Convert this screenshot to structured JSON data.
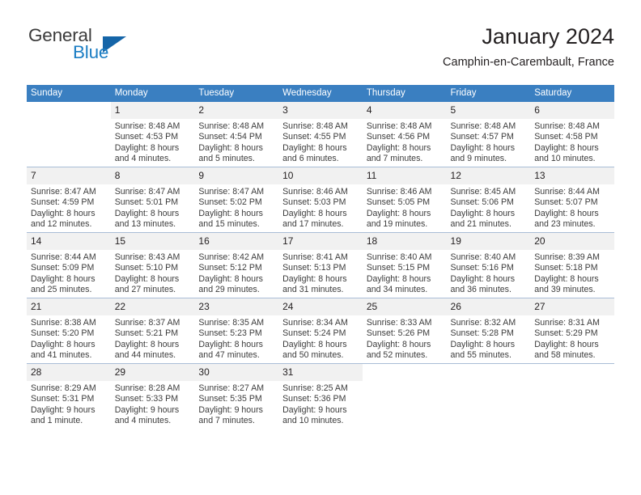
{
  "brand": {
    "word1": "General",
    "word2": "Blue",
    "triangle_color": "#1565a8",
    "blue_color": "#1c7ec4"
  },
  "header": {
    "title": "January 2024",
    "location": "Camphin-en-Carembault, France"
  },
  "calendar": {
    "header_bg": "#3a7fc1",
    "daynum_bg": "#f1f1f1",
    "weekdays": [
      "Sunday",
      "Monday",
      "Tuesday",
      "Wednesday",
      "Thursday",
      "Friday",
      "Saturday"
    ],
    "weeks": [
      [
        {
          "day": "",
          "blank": true,
          "lines": []
        },
        {
          "day": "1",
          "lines": [
            "Sunrise: 8:48 AM",
            "Sunset: 4:53 PM",
            "Daylight: 8 hours",
            "and 4 minutes."
          ]
        },
        {
          "day": "2",
          "lines": [
            "Sunrise: 8:48 AM",
            "Sunset: 4:54 PM",
            "Daylight: 8 hours",
            "and 5 minutes."
          ]
        },
        {
          "day": "3",
          "lines": [
            "Sunrise: 8:48 AM",
            "Sunset: 4:55 PM",
            "Daylight: 8 hours",
            "and 6 minutes."
          ]
        },
        {
          "day": "4",
          "lines": [
            "Sunrise: 8:48 AM",
            "Sunset: 4:56 PM",
            "Daylight: 8 hours",
            "and 7 minutes."
          ]
        },
        {
          "day": "5",
          "lines": [
            "Sunrise: 8:48 AM",
            "Sunset: 4:57 PM",
            "Daylight: 8 hours",
            "and 9 minutes."
          ]
        },
        {
          "day": "6",
          "lines": [
            "Sunrise: 8:48 AM",
            "Sunset: 4:58 PM",
            "Daylight: 8 hours",
            "and 10 minutes."
          ]
        }
      ],
      [
        {
          "day": "7",
          "lines": [
            "Sunrise: 8:47 AM",
            "Sunset: 4:59 PM",
            "Daylight: 8 hours",
            "and 12 minutes."
          ]
        },
        {
          "day": "8",
          "lines": [
            "Sunrise: 8:47 AM",
            "Sunset: 5:01 PM",
            "Daylight: 8 hours",
            "and 13 minutes."
          ]
        },
        {
          "day": "9",
          "lines": [
            "Sunrise: 8:47 AM",
            "Sunset: 5:02 PM",
            "Daylight: 8 hours",
            "and 15 minutes."
          ]
        },
        {
          "day": "10",
          "lines": [
            "Sunrise: 8:46 AM",
            "Sunset: 5:03 PM",
            "Daylight: 8 hours",
            "and 17 minutes."
          ]
        },
        {
          "day": "11",
          "lines": [
            "Sunrise: 8:46 AM",
            "Sunset: 5:05 PM",
            "Daylight: 8 hours",
            "and 19 minutes."
          ]
        },
        {
          "day": "12",
          "lines": [
            "Sunrise: 8:45 AM",
            "Sunset: 5:06 PM",
            "Daylight: 8 hours",
            "and 21 minutes."
          ]
        },
        {
          "day": "13",
          "lines": [
            "Sunrise: 8:44 AM",
            "Sunset: 5:07 PM",
            "Daylight: 8 hours",
            "and 23 minutes."
          ]
        }
      ],
      [
        {
          "day": "14",
          "lines": [
            "Sunrise: 8:44 AM",
            "Sunset: 5:09 PM",
            "Daylight: 8 hours",
            "and 25 minutes."
          ]
        },
        {
          "day": "15",
          "lines": [
            "Sunrise: 8:43 AM",
            "Sunset: 5:10 PM",
            "Daylight: 8 hours",
            "and 27 minutes."
          ]
        },
        {
          "day": "16",
          "lines": [
            "Sunrise: 8:42 AM",
            "Sunset: 5:12 PM",
            "Daylight: 8 hours",
            "and 29 minutes."
          ]
        },
        {
          "day": "17",
          "lines": [
            "Sunrise: 8:41 AM",
            "Sunset: 5:13 PM",
            "Daylight: 8 hours",
            "and 31 minutes."
          ]
        },
        {
          "day": "18",
          "lines": [
            "Sunrise: 8:40 AM",
            "Sunset: 5:15 PM",
            "Daylight: 8 hours",
            "and 34 minutes."
          ]
        },
        {
          "day": "19",
          "lines": [
            "Sunrise: 8:40 AM",
            "Sunset: 5:16 PM",
            "Daylight: 8 hours",
            "and 36 minutes."
          ]
        },
        {
          "day": "20",
          "lines": [
            "Sunrise: 8:39 AM",
            "Sunset: 5:18 PM",
            "Daylight: 8 hours",
            "and 39 minutes."
          ]
        }
      ],
      [
        {
          "day": "21",
          "lines": [
            "Sunrise: 8:38 AM",
            "Sunset: 5:20 PM",
            "Daylight: 8 hours",
            "and 41 minutes."
          ]
        },
        {
          "day": "22",
          "lines": [
            "Sunrise: 8:37 AM",
            "Sunset: 5:21 PM",
            "Daylight: 8 hours",
            "and 44 minutes."
          ]
        },
        {
          "day": "23",
          "lines": [
            "Sunrise: 8:35 AM",
            "Sunset: 5:23 PM",
            "Daylight: 8 hours",
            "and 47 minutes."
          ]
        },
        {
          "day": "24",
          "lines": [
            "Sunrise: 8:34 AM",
            "Sunset: 5:24 PM",
            "Daylight: 8 hours",
            "and 50 minutes."
          ]
        },
        {
          "day": "25",
          "lines": [
            "Sunrise: 8:33 AM",
            "Sunset: 5:26 PM",
            "Daylight: 8 hours",
            "and 52 minutes."
          ]
        },
        {
          "day": "26",
          "lines": [
            "Sunrise: 8:32 AM",
            "Sunset: 5:28 PM",
            "Daylight: 8 hours",
            "and 55 minutes."
          ]
        },
        {
          "day": "27",
          "lines": [
            "Sunrise: 8:31 AM",
            "Sunset: 5:29 PM",
            "Daylight: 8 hours",
            "and 58 minutes."
          ]
        }
      ],
      [
        {
          "day": "28",
          "lines": [
            "Sunrise: 8:29 AM",
            "Sunset: 5:31 PM",
            "Daylight: 9 hours",
            "and 1 minute."
          ]
        },
        {
          "day": "29",
          "lines": [
            "Sunrise: 8:28 AM",
            "Sunset: 5:33 PM",
            "Daylight: 9 hours",
            "and 4 minutes."
          ]
        },
        {
          "day": "30",
          "lines": [
            "Sunrise: 8:27 AM",
            "Sunset: 5:35 PM",
            "Daylight: 9 hours",
            "and 7 minutes."
          ]
        },
        {
          "day": "31",
          "lines": [
            "Sunrise: 8:25 AM",
            "Sunset: 5:36 PM",
            "Daylight: 9 hours",
            "and 10 minutes."
          ]
        },
        {
          "day": "",
          "blank": true,
          "lines": []
        },
        {
          "day": "",
          "blank": true,
          "lines": []
        },
        {
          "day": "",
          "blank": true,
          "lines": []
        }
      ]
    ]
  }
}
